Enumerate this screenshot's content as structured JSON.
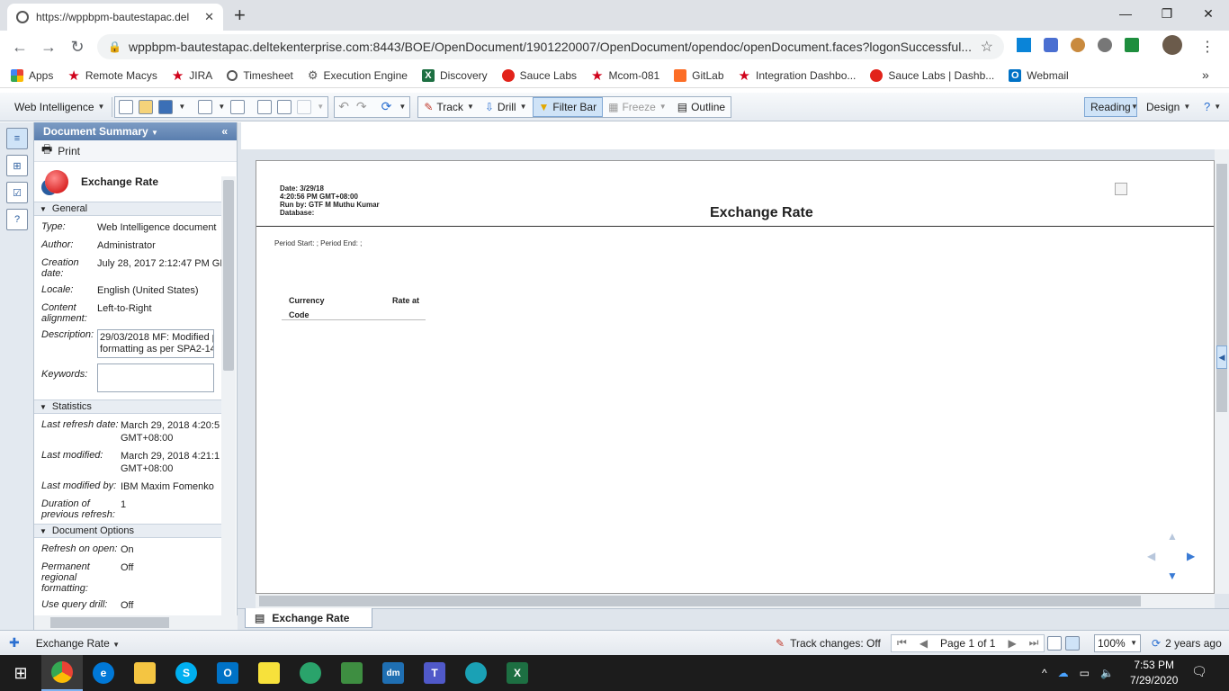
{
  "browser": {
    "tab_title": "https://wppbpm-bautestapac.del",
    "new_tab": "+",
    "url": "wppbpm-bautestapac.deltekenterprise.com:8443/BOE/OpenDocument/1901220007/OpenDocument/opendoc/openDocument.faces?logonSuccessful...",
    "bookmarks": [
      "Apps",
      "Remote Macys",
      "JIRA",
      "Timesheet",
      "Execution Engine",
      "Discovery",
      "Sauce Labs",
      "Mcom-081",
      "GitLab",
      "Integration Dashbo...",
      "Sauce Labs | Dashb...",
      "Webmail"
    ],
    "more": "»"
  },
  "toolbar": {
    "web_intelligence": "Web Intelligence",
    "track": "Track",
    "drill": "Drill",
    "filter_bar": "Filter Bar",
    "freeze": "Freeze",
    "outline": "Outline",
    "reading": "Reading",
    "design": "Design"
  },
  "panel": {
    "header": "Document Summary",
    "print": "Print",
    "doc_title": "Exchange Rate",
    "general": "General",
    "type_k": "Type:",
    "type_v": "Web Intelligence document",
    "author_k": "Author:",
    "author_v": "Administrator",
    "created_k": "Creation date:",
    "created_v": "July 28, 2017 2:12:47 PM GM",
    "locale_k": "Locale:",
    "locale_v": "English (United States)",
    "align_k": "Content alignment:",
    "align_v": "Left-to-Right",
    "desc_k": "Description:",
    "desc_l1": "29/03/2018 MF: Modified pa",
    "desc_l2": "formatting as per SPA2-146",
    "keywords_k": "Keywords:",
    "statistics": "Statistics",
    "refresh_k": "Last refresh date:",
    "refresh_v1": "March 29, 2018 4:20:5",
    "refresh_v2": "GMT+08:00",
    "modified_k": "Last modified:",
    "modified_v1": "March 29, 2018 4:21:1",
    "modified_v2": "GMT+08:00",
    "modby_k": "Last modified by:",
    "modby_v": "IBM Maxim Fomenko",
    "duration_k": "Duration of previous refresh:",
    "duration_v": "1",
    "docopts": "Document Options",
    "refopen_k": "Refresh on open:",
    "refopen_v": "On",
    "perm_k": "Permanent regional formatting:",
    "perm_v": "Off",
    "qdrill_k": "Use query drill:",
    "qdrill_v": "Off"
  },
  "report": {
    "date": "Date: 3/29/18",
    "time": "4:20:56 PM GMT+08:00",
    "runby": "Run by: GTF M Muthu Kumar",
    "database": "Database:",
    "title": "Exchange Rate",
    "period": "Period Start: ; Period End: ;",
    "col1_l1": "Currency",
    "col1_l2": "Code",
    "col2": "Rate at"
  },
  "report_tab": "Exchange Rate",
  "status": {
    "report_name": "Exchange Rate",
    "track_changes": "Track changes: Off",
    "page": "Page 1 of 1",
    "zoom": "100%",
    "refreshed": "2 years ago"
  },
  "taskbar": {
    "time": "7:53 PM",
    "date": "7/29/2020"
  }
}
